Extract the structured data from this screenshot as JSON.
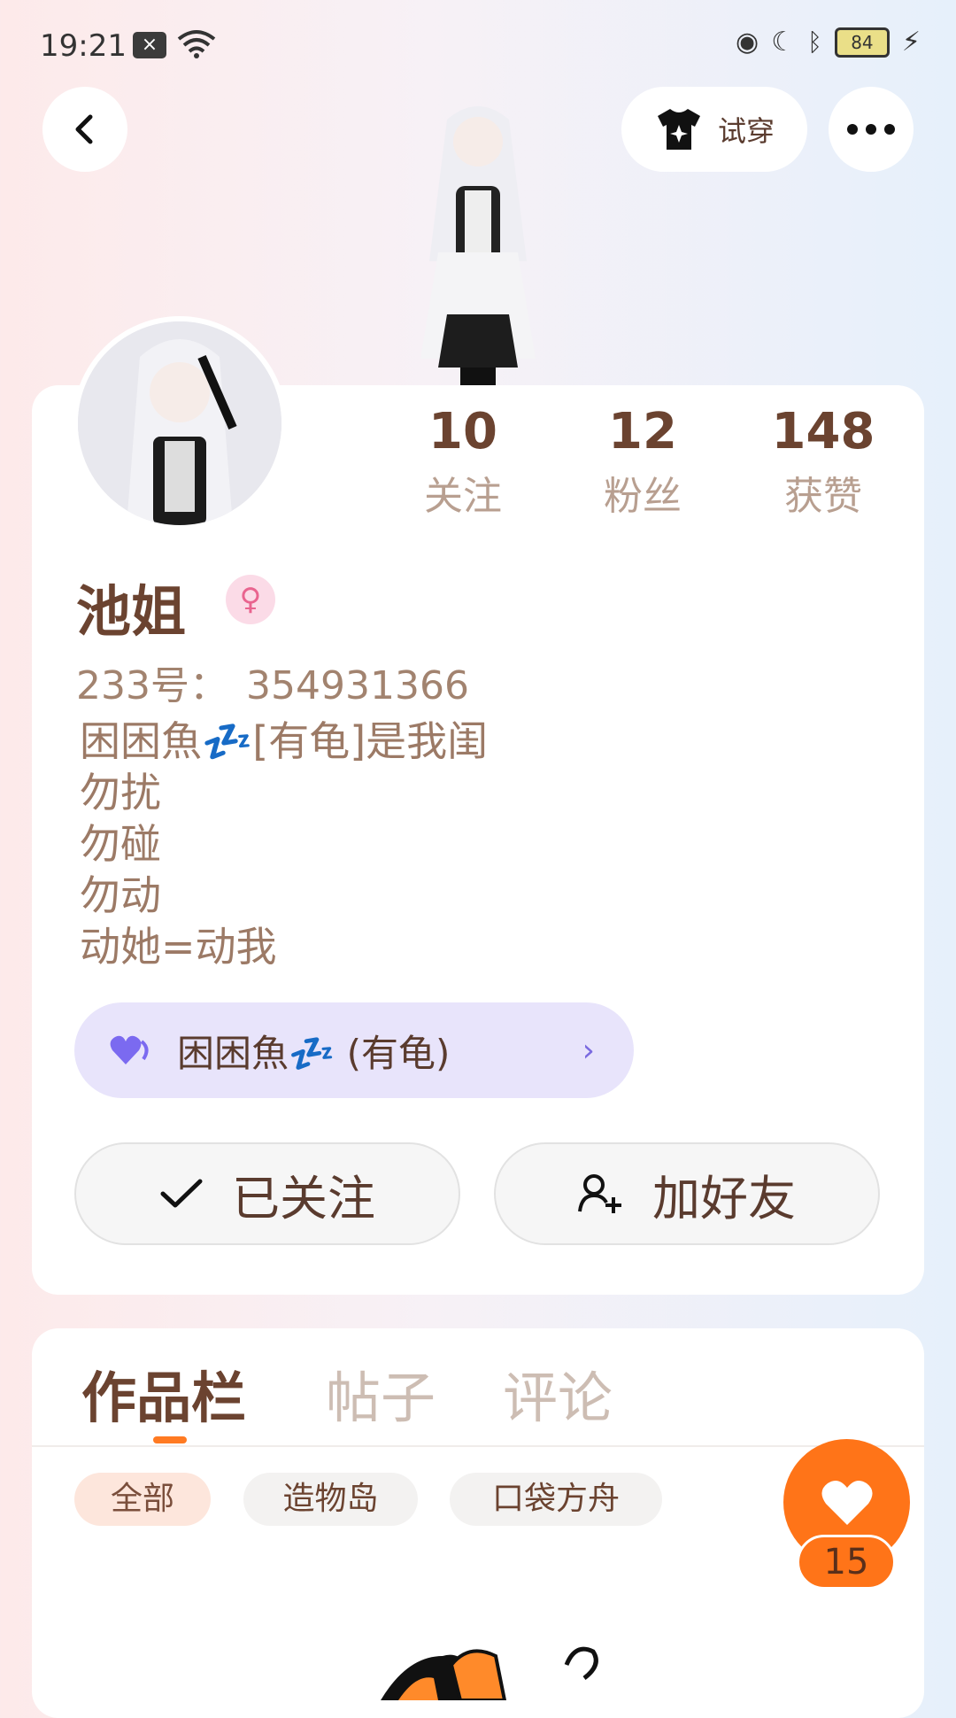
{
  "status_bar": {
    "time": "19:21",
    "notification_badge": "×",
    "battery_level": "84"
  },
  "header": {
    "tryon_label": "试穿",
    "icons": [
      "back-icon",
      "shirt-icon",
      "more-icon"
    ]
  },
  "profile": {
    "stats": [
      {
        "value": "10",
        "label": "关注"
      },
      {
        "value": "12",
        "label": "粉丝"
      },
      {
        "value": "148",
        "label": "获赞"
      }
    ],
    "name": "池姐",
    "gender_symbol": "♀",
    "id_label": "233号：",
    "id_value": "354931366",
    "bio_lines": [
      "困困魚💤[有龟]是我闺",
      "勿扰",
      "勿碰",
      "勿动",
      "动她=动我"
    ],
    "group_chip_label": "困困魚💤 (有龟)",
    "follow_button_label": "已关注",
    "add_friend_button_label": "加好友"
  },
  "content": {
    "tabs": [
      "作品栏",
      "帖子",
      "评论"
    ],
    "active_tab": "作品栏",
    "filters": [
      "全部",
      "造物岛",
      "口袋方舟"
    ],
    "active_filter": "全部",
    "like_count": "15"
  },
  "colors": {
    "accent_orange": "#ff7418",
    "name_brown": "#6b4330",
    "group_chip_bg": "#e8e4fb"
  }
}
